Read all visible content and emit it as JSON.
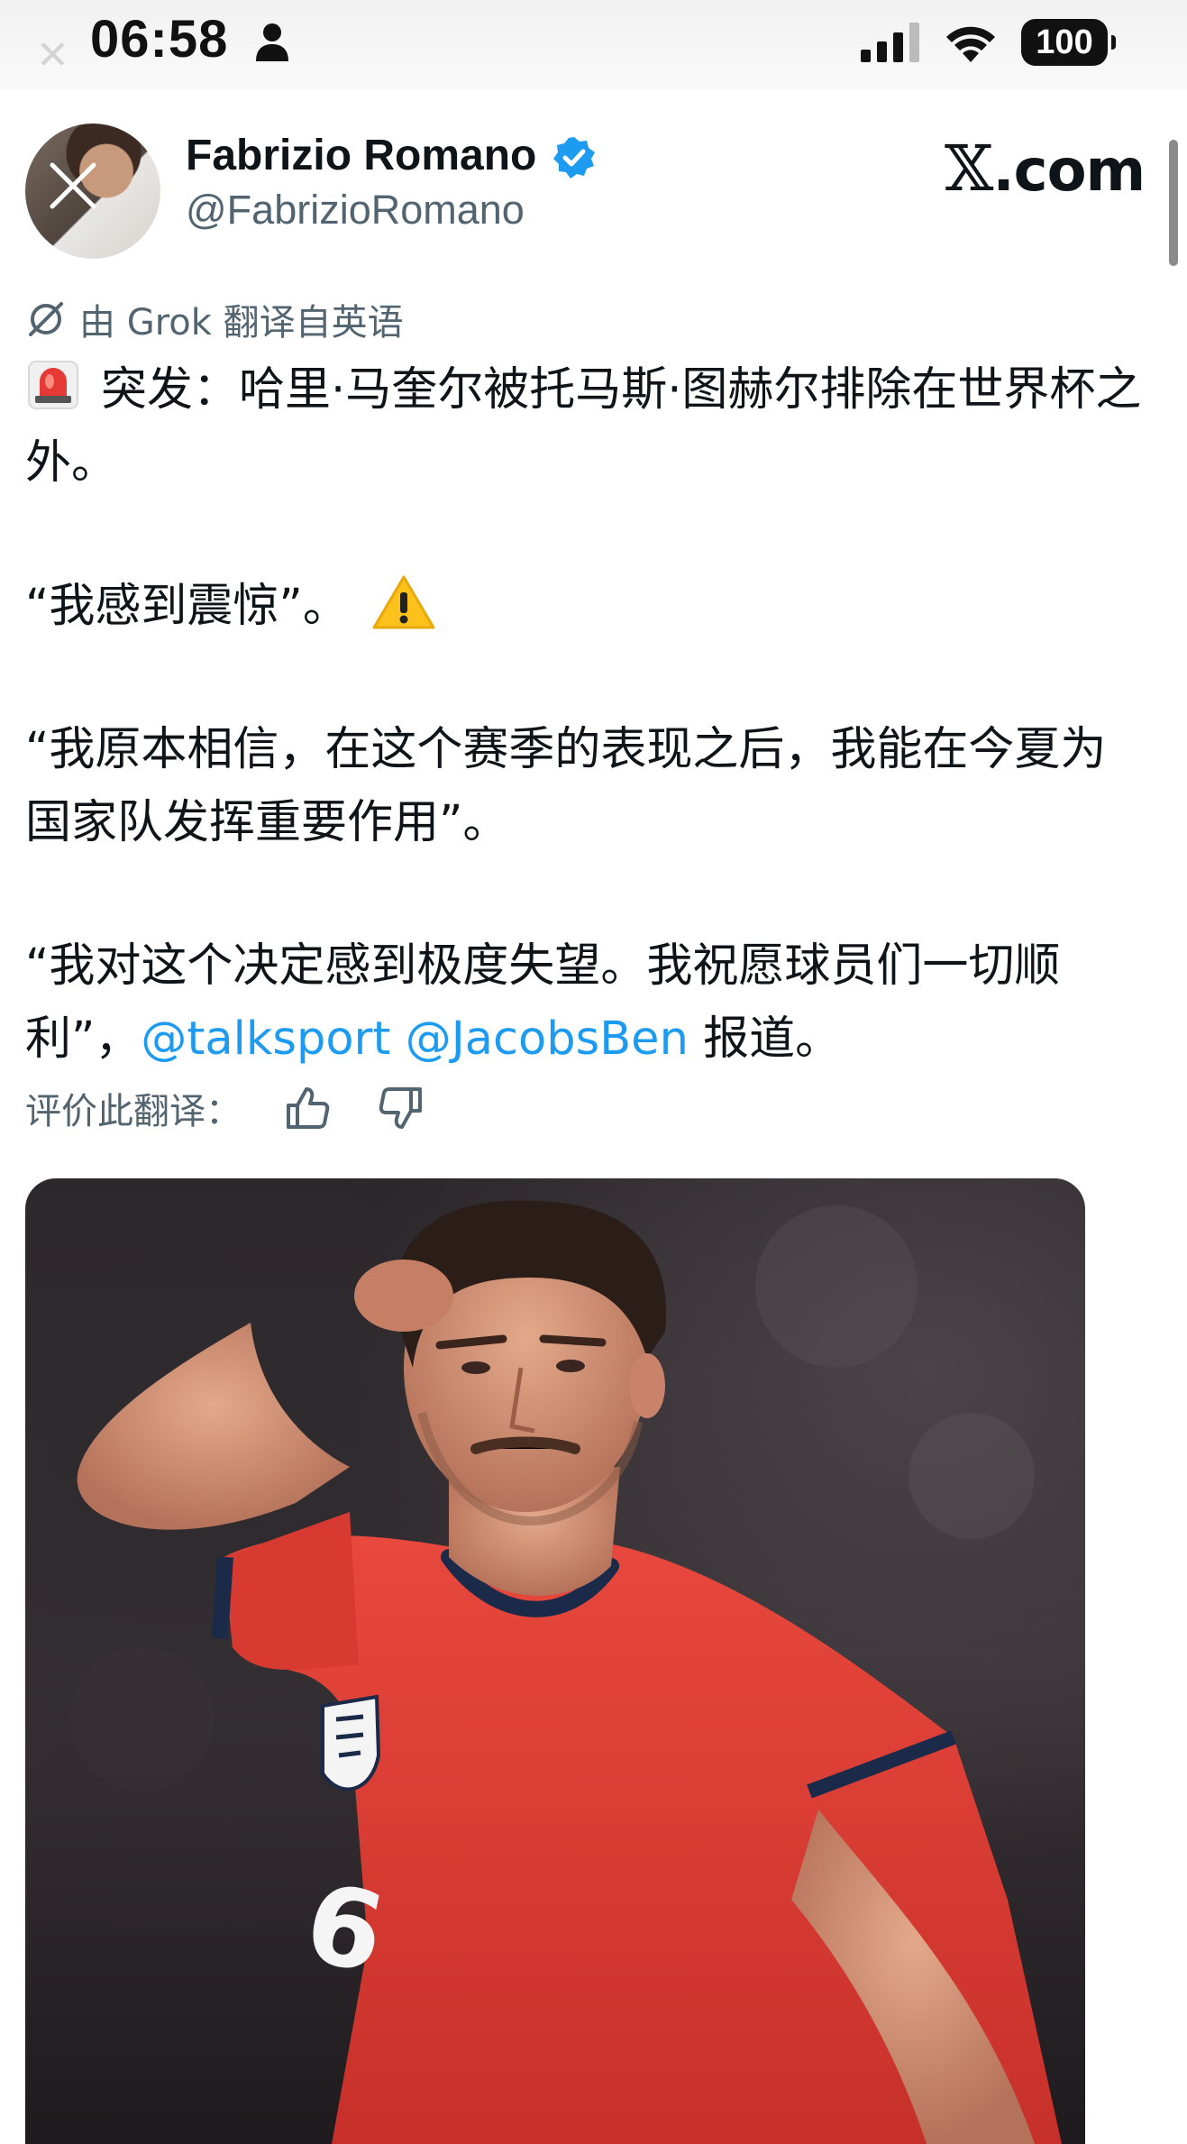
{
  "status_bar": {
    "time": "06:58",
    "battery": "100"
  },
  "header": {
    "author_name": "Fabrizio Romano",
    "author_handle": "@FabrizioRomano",
    "site_label_x": "𝕏",
    "site_label_rest": ".com"
  },
  "translation": {
    "note": "由 Grok 翻译自英语",
    "rate_label": "评价此翻译："
  },
  "tweet": {
    "line1": "突发：哈里·马奎尔被托马斯·图赫尔排除在世界杯之外。",
    "line2": "“我感到震惊”。",
    "line3": "“我原本相信，在这个赛季的表现之后，我能在今夏为国家队发挥重要作用”。",
    "line4_text": "“我对这个决定感到极度失望。我祝愿球员们一切顺利”，",
    "mention1": "@talksport",
    "mention2": "@JacobsBen",
    "line4_suffix": "报道。"
  },
  "photo": {
    "shirt_number": "6"
  },
  "colors": {
    "link": "#1d9bf0",
    "verified": "#1d9bf0",
    "secondary_text": "#536471"
  },
  "icons": [
    "person-icon",
    "cellular-signal-icon",
    "wifi-icon",
    "battery-icon",
    "verified-badge-icon",
    "grok-icon",
    "siren-emoji-icon",
    "warning-emoji-icon",
    "thumbs-up-icon",
    "thumbs-down-icon"
  ]
}
